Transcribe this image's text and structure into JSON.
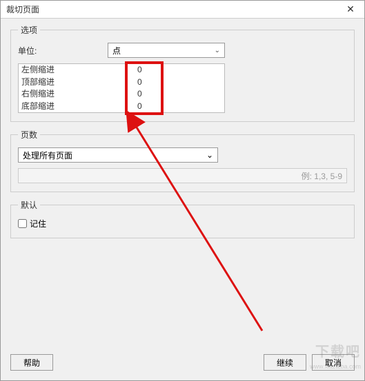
{
  "window": {
    "title": "裁切页面"
  },
  "options": {
    "legend": "选项",
    "unit_label": "单位:",
    "unit_value": "点",
    "indents": {
      "left_label": "左侧缩进",
      "top_label": "顶部缩进",
      "right_label": "右侧缩进",
      "bottom_label": "底部缩进",
      "left_value": "0",
      "top_value": "0",
      "right_value": "0",
      "bottom_value": "0"
    }
  },
  "pages": {
    "legend": "页数",
    "select_value": "处理所有页面",
    "hint": "例: 1,3, 5-9"
  },
  "defaults": {
    "legend": "默认",
    "remember_label": "记住"
  },
  "buttons": {
    "help": "帮助",
    "continue": "继续",
    "cancel": "取消"
  },
  "annotation": {
    "highlight_color": "#d11",
    "arrow_color": "#d11"
  },
  "watermark": {
    "main": "下载吧",
    "sub": "www.xiazaiba.com"
  }
}
